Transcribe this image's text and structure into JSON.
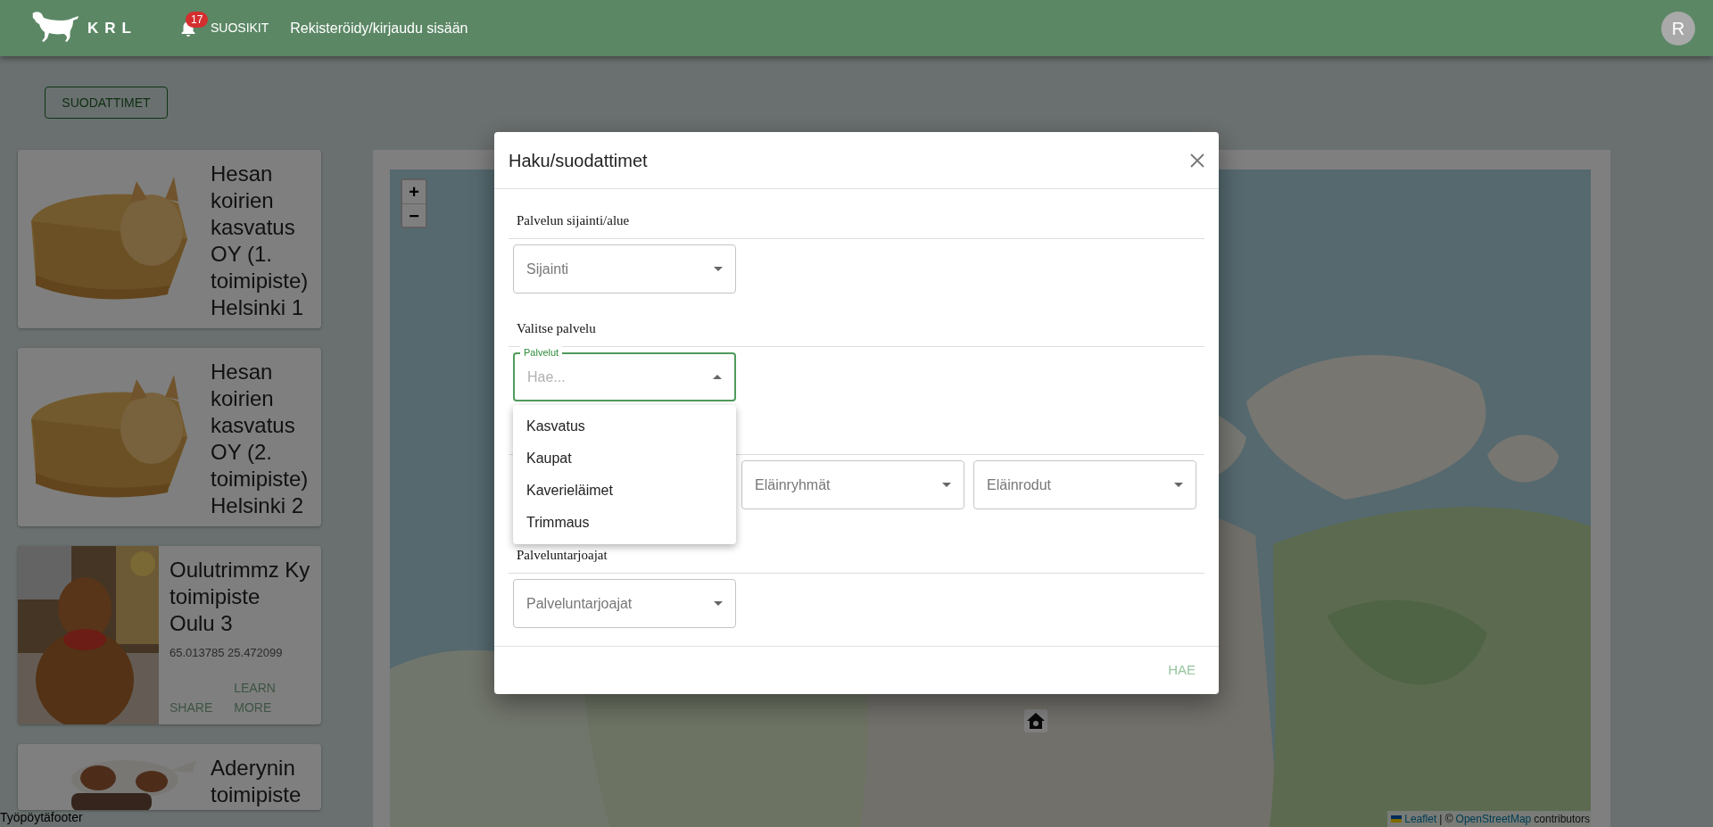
{
  "header": {
    "logo_text": "KRL",
    "favorites": {
      "badge": "17",
      "label": "SUOSIKIT"
    },
    "login_link": "Rekisteröidy/kirjaudu sisään",
    "avatar": "R"
  },
  "filter_button": "SUODATTIMET",
  "cards": [
    {
      "title": "Hesan koirien kasvatus OY (1. toimipiste) Helsinki 1"
    },
    {
      "title": "Hesan koirien kasvatus OY (2. toimipiste) Helsinki 2"
    },
    {
      "title": "Oulutrimmz Ky toimipiste Oulu 3",
      "coords": "65.013785 25.472099",
      "actions": [
        "SHARE",
        "LEARN MORE"
      ]
    },
    {
      "title": "Aderynin toimipiste"
    }
  ],
  "map": {
    "zoom_in": "+",
    "zoom_out": "−",
    "attribution": {
      "link": "Leaflet",
      "separator": "| ©",
      "source": "OpenStreetMap",
      "suffix": "contributors"
    }
  },
  "footer": "Työpöytäfooter",
  "modal": {
    "title": "Haku/suodattimet",
    "sections": [
      {
        "label": "Palvelun sijainti/alue",
        "selects": [
          {
            "placeholder": "Sijainti",
            "expanded": false
          }
        ]
      },
      {
        "label": "Valitse palvelu",
        "selects": [
          {
            "label": "Palvelut",
            "placeholder": "Hae...",
            "expanded": true,
            "options": [
              "Kasvatus",
              "Kaupat",
              "Kaverieläimet",
              "Trimmaus"
            ]
          }
        ]
      },
      {
        "selects": [
          {
            "placeholder": "Eläinryhmät",
            "expanded": false
          },
          {
            "placeholder": "Eläinrodut",
            "expanded": false
          }
        ]
      },
      {
        "label": "Palveluntarjoajat",
        "selects": [
          {
            "placeholder": "Palveluntarjoajat",
            "expanded": false
          }
        ]
      }
    ],
    "submit": "HAE"
  }
}
